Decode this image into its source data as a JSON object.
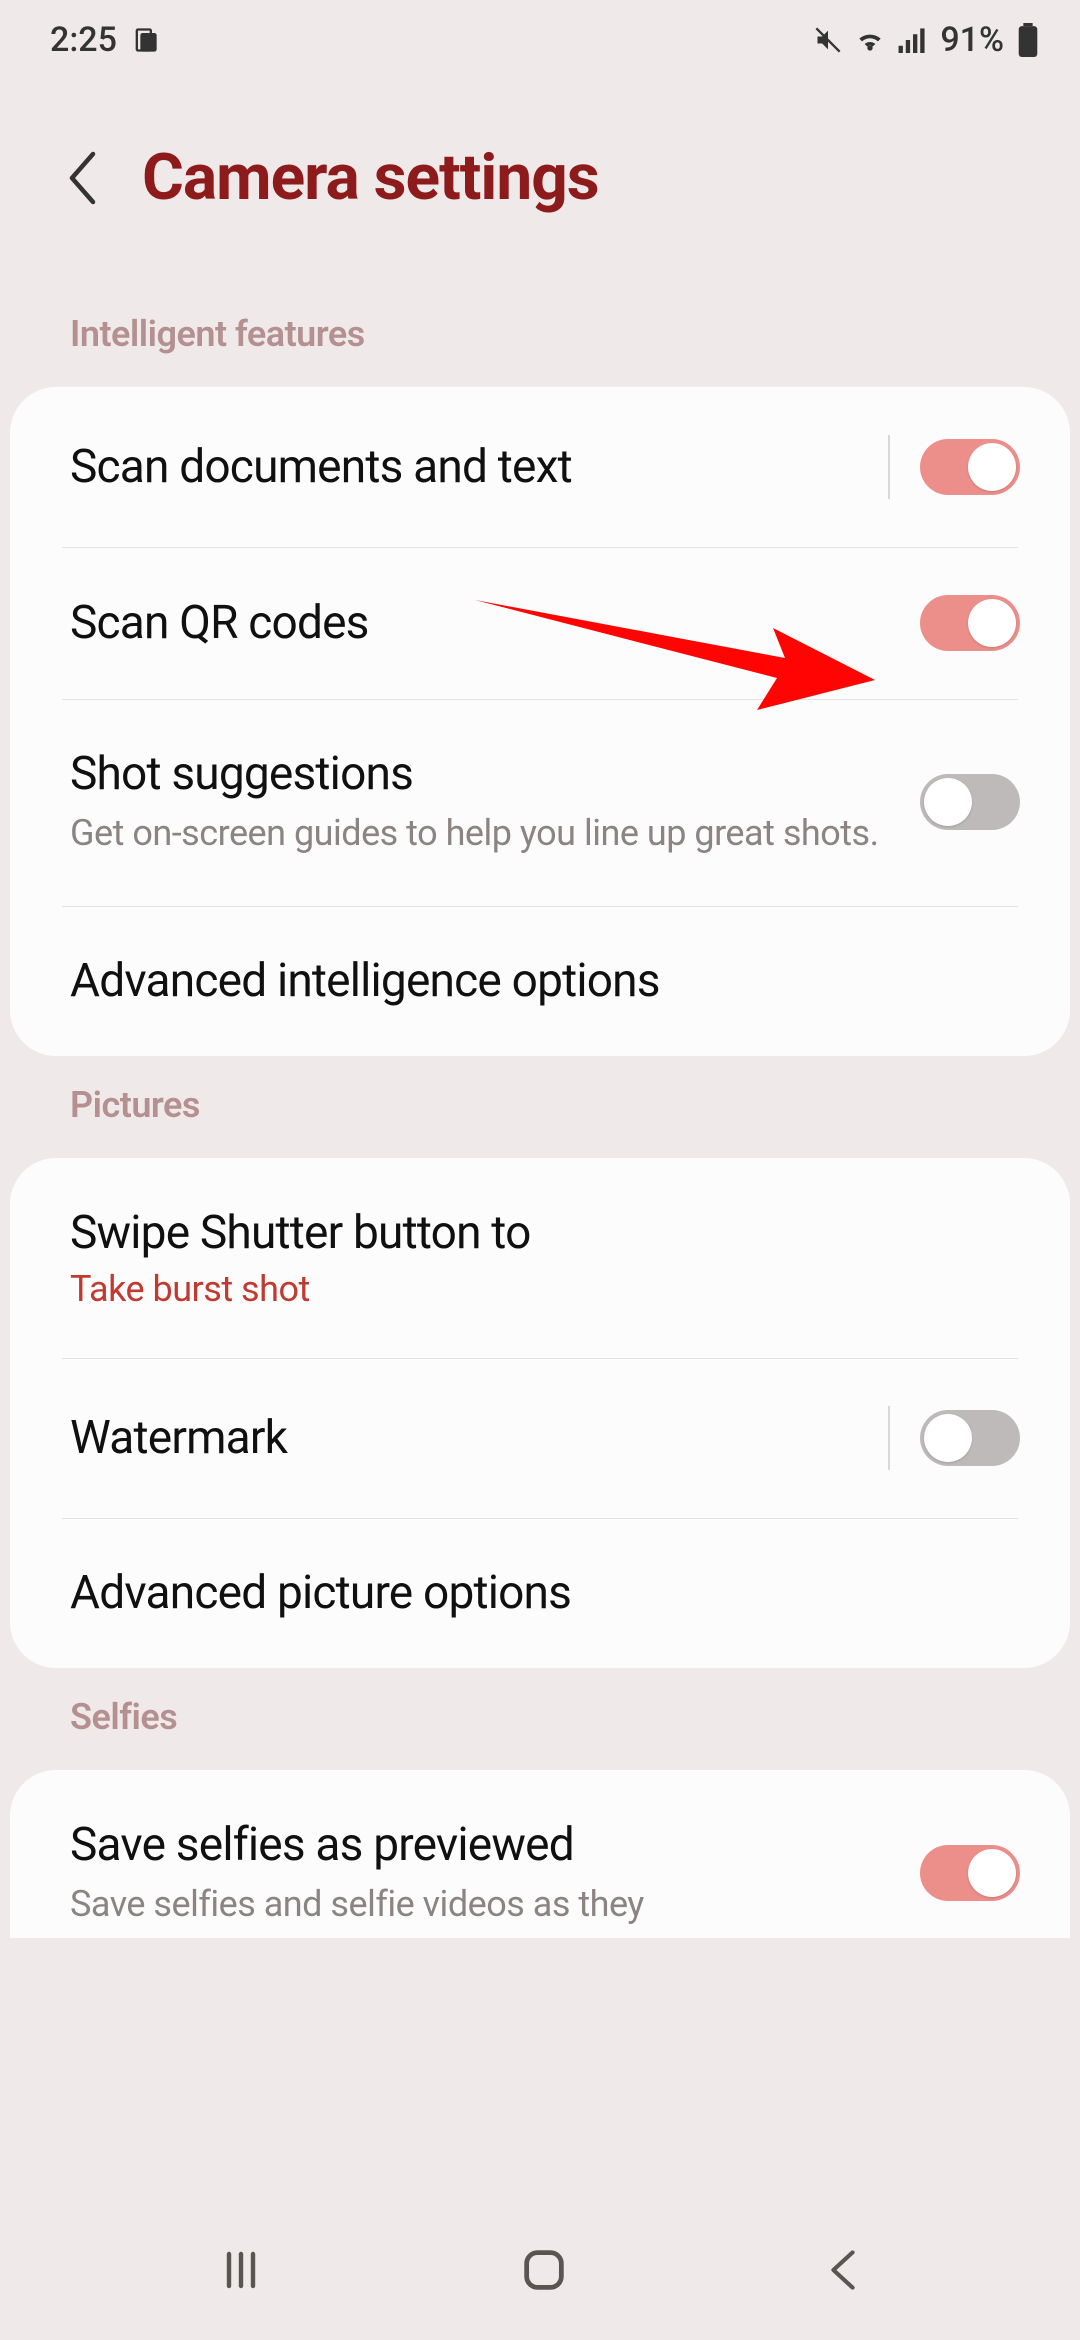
{
  "statusbar": {
    "time": "2:25",
    "battery": "91%"
  },
  "header": {
    "title": "Camera settings"
  },
  "sections": {
    "intelligent": {
      "label": "Intelligent features",
      "scan_docs": {
        "title": "Scan documents and text",
        "enabled": true
      },
      "scan_qr": {
        "title": "Scan QR codes",
        "enabled": true
      },
      "shot_suggestions": {
        "title": "Shot suggestions",
        "subtitle": "Get on-screen guides to help you line up great shots.",
        "enabled": false
      },
      "advanced_ai": {
        "title": "Advanced intelligence options"
      }
    },
    "pictures": {
      "label": "Pictures",
      "swipe_shutter": {
        "title": "Swipe Shutter button to",
        "value": "Take burst shot"
      },
      "watermark": {
        "title": "Watermark",
        "enabled": false
      },
      "advanced_pic": {
        "title": "Advanced picture options"
      }
    },
    "selfies": {
      "label": "Selfies",
      "save_as_previewed": {
        "title": "Save selfies as previewed",
        "subtitle": "Save selfies and selfie videos as they",
        "enabled": true
      }
    }
  },
  "colors": {
    "accent": "#8e1b1c",
    "toggle_on": "#ec8e8a",
    "toggle_off": "#bdbab9",
    "annotation": "#ff0000"
  }
}
